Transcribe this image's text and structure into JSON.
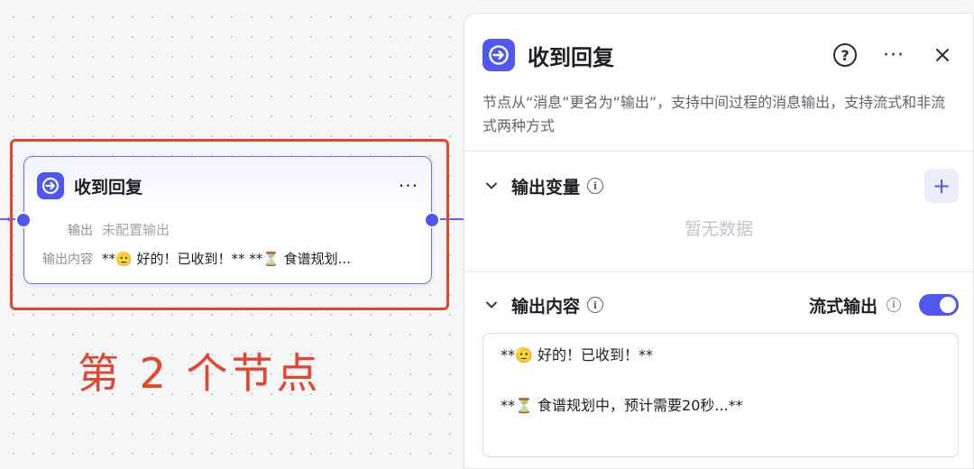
{
  "node": {
    "title": "收到回复",
    "more_label": "···",
    "output_label": "输出",
    "output_value": "未配置输出",
    "content_label": "输出内容",
    "content_value": "**🫡 好的！已收到！** **⏳ 食谱规划..."
  },
  "annotation": {
    "text": "第 2 个节点",
    "color": "#e8432c"
  },
  "panel": {
    "title": "收到回复",
    "description": "节点从“消息”更名为“输出”，支持中间过程的消息输出，支持流式和非流式两种方式",
    "more_label": "···",
    "output_vars": {
      "title": "输出变量",
      "empty_text": "暂无数据",
      "add_label": "+"
    },
    "output_content": {
      "title": "输出内容",
      "stream_label": "流式输出",
      "stream_enabled": true,
      "text": "**🫡 好的！已收到！**\n\n**⏳ 食谱规划中，预计需要20秒...**"
    }
  },
  "colors": {
    "accent": "#4e57ef",
    "highlight": "#e8432c"
  },
  "icons": {
    "node_icon": "reply-arrow-icon",
    "help": "help-icon",
    "close": "close-icon",
    "info": "info-icon",
    "chevron": "chevron-down-icon"
  }
}
